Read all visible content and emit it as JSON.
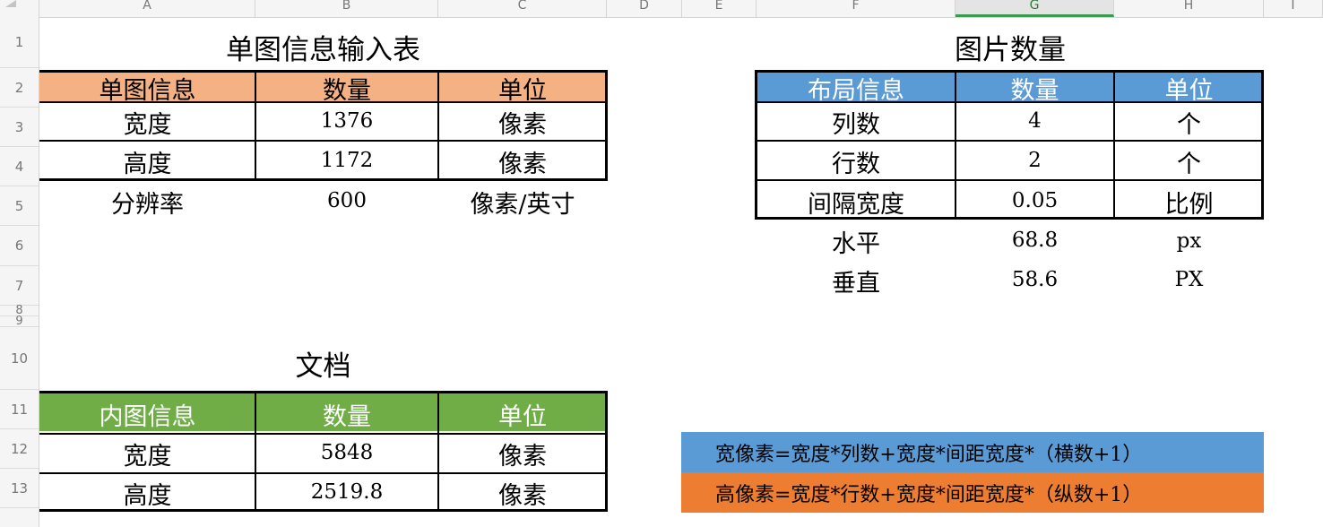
{
  "columns": [
    "A",
    "B",
    "C",
    "D",
    "E",
    "F",
    "G",
    "H",
    "I"
  ],
  "rows": [
    "1",
    "2",
    "3",
    "4",
    "5",
    "6",
    "7",
    "8",
    "9",
    "10",
    "11",
    "12",
    "13"
  ],
  "selected_column": "G",
  "colors": {
    "single_header": "#f4b183",
    "layout_header": "#5b9bd5",
    "inner_header": "#70ad47",
    "formula_width": "#5b9bd5",
    "formula_height": "#ed7d31"
  },
  "single": {
    "title": "单图信息输入表",
    "headers": [
      "单图信息",
      "数量",
      "单位"
    ],
    "rows": [
      {
        "label": "宽度",
        "value": "1376",
        "unit": "像素"
      },
      {
        "label": "高度",
        "value": "1172",
        "unit": "像素"
      }
    ],
    "resolution": {
      "label": "分辨率",
      "value": "600",
      "unit": "像素/英寸"
    }
  },
  "layout": {
    "title": "图片数量",
    "headers": [
      "布局信息",
      "数量",
      "单位"
    ],
    "rows": [
      {
        "label": "列数",
        "value": "4",
        "unit": "个"
      },
      {
        "label": "行数",
        "value": "2",
        "unit": "个"
      },
      {
        "label": "间隔宽度",
        "value": "0.05",
        "unit": "比例"
      }
    ],
    "extra": [
      {
        "label": "水平",
        "value": "68.8",
        "unit": "px"
      },
      {
        "label": "垂直",
        "value": "58.6",
        "unit": "PX"
      }
    ]
  },
  "document": {
    "title": "文档",
    "headers": [
      "内图信息",
      "数量",
      "单位"
    ],
    "rows": [
      {
        "label": "宽度",
        "value": "5848",
        "unit": "像素"
      },
      {
        "label": "高度",
        "value": "2519.8",
        "unit": "像素"
      }
    ]
  },
  "formulas": {
    "width": "宽像素=宽度*列数+宽度*间距宽度*（横数+1）",
    "height": "高像素=宽度*行数+宽度*间距宽度*（纵数+1）"
  }
}
